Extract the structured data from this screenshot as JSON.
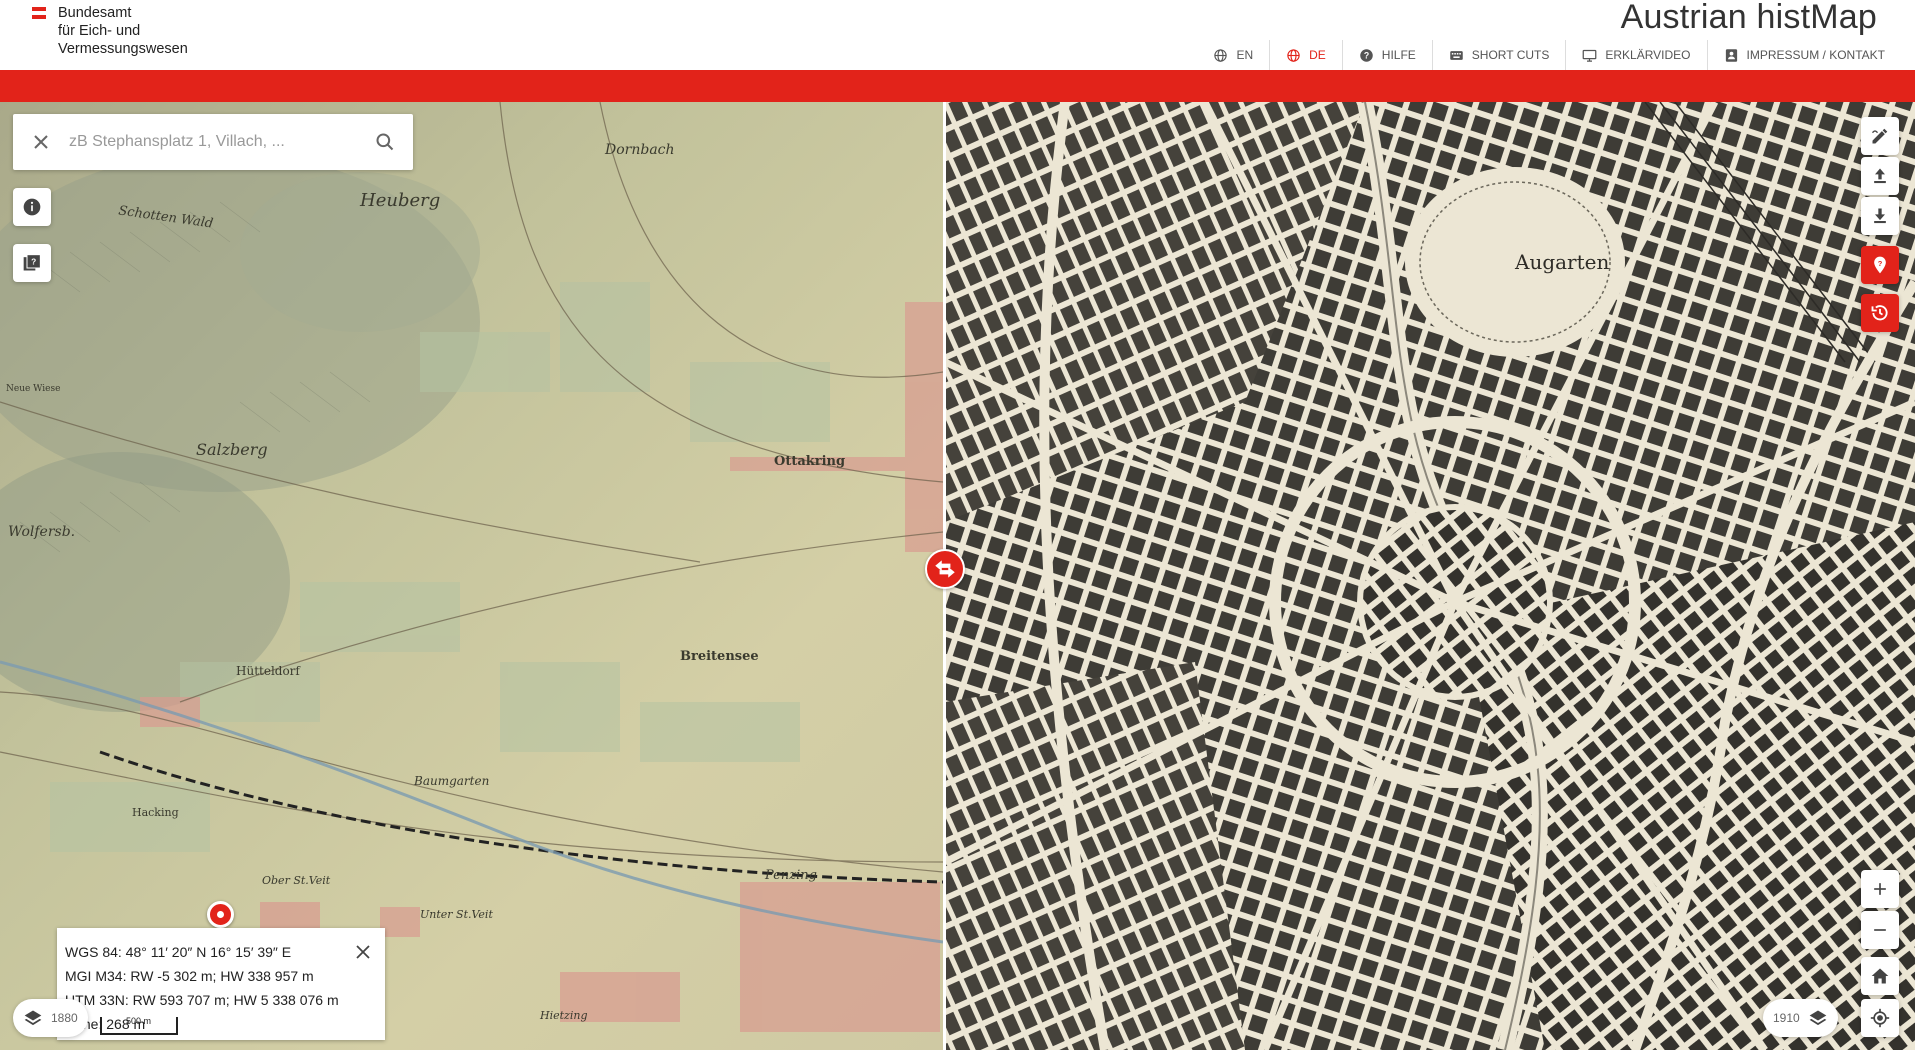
{
  "header": {
    "logo_lines": [
      "Bundesamt",
      "für Eich- und",
      "Vermessungswesen"
    ],
    "app_title": "Austrian histMap",
    "nav": [
      {
        "label": "EN",
        "icon": "globe-icon",
        "active": false
      },
      {
        "label": "DE",
        "icon": "globe-icon",
        "active": true
      },
      {
        "label": "HILFE",
        "icon": "help-icon",
        "active": false
      },
      {
        "label": "SHORT CUTS",
        "icon": "keyboard-icon",
        "active": false
      },
      {
        "label": "ERKLÄRVIDEO",
        "icon": "monitor-icon",
        "active": false
      },
      {
        "label": "IMPRESSUM / KONTAKT",
        "icon": "contact-icon",
        "active": false
      }
    ]
  },
  "search": {
    "placeholder": "zB Stephansplatz 1, Villach, ...",
    "value": ""
  },
  "map_left": {
    "year": "1880",
    "labels": [
      "Dornbach",
      "Heuberg",
      "Schotten Wald",
      "Salzberg",
      "Wolfersb.",
      "Ottakring",
      "Breitensee",
      "Hütteldorf",
      "Baumgarten",
      "Penzing",
      "Ober St.Veit",
      "Hacking",
      "Unter St.Veit",
      "Hietzing",
      "Neue Wiese",
      "Augarten"
    ]
  },
  "map_right": {
    "year": "1910",
    "labels": [
      "Augarten"
    ]
  },
  "coords": {
    "wgs": "WGS 84: 48° 11′ 20″ N 16° 15′ 39″ E",
    "mgi": "MGI M34: RW -5 302 m; HW 338 957 m",
    "utm": "UTM 33N: RW 593 707 m; HW 5 338 076 m",
    "height": "Höhe: 268 m"
  },
  "scalebar": "500 m",
  "colors": {
    "accent": "#e2231a",
    "header_bg": "#ffffff"
  }
}
